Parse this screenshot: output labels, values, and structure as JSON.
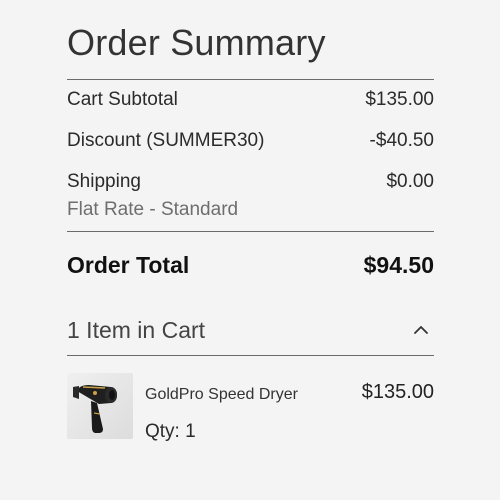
{
  "summary": {
    "title": "Order Summary",
    "cart_subtotal_label": "Cart Subtotal",
    "cart_subtotal_value": "$135.00",
    "discount_label": "Discount (SUMMER30)",
    "discount_value": "-$40.50",
    "shipping_label": "Shipping",
    "shipping_value": "$0.00",
    "shipping_method": "Flat Rate - Standard",
    "order_total_label": "Order Total",
    "order_total_value": "$94.50"
  },
  "cart": {
    "toggle_label": "1 Item in Cart",
    "toggle_icon": "chevron-up-icon",
    "items": [
      {
        "name": "GoldPro Speed Dryer",
        "price": "$135.00",
        "qty": "Qty: 1",
        "thumbnail": "hair-dryer-image"
      }
    ]
  },
  "colors": {
    "background": "#f4f4f4",
    "text": "#1a1a1a",
    "muted": "#6e6e6e",
    "divider": "#6b6b6b"
  }
}
